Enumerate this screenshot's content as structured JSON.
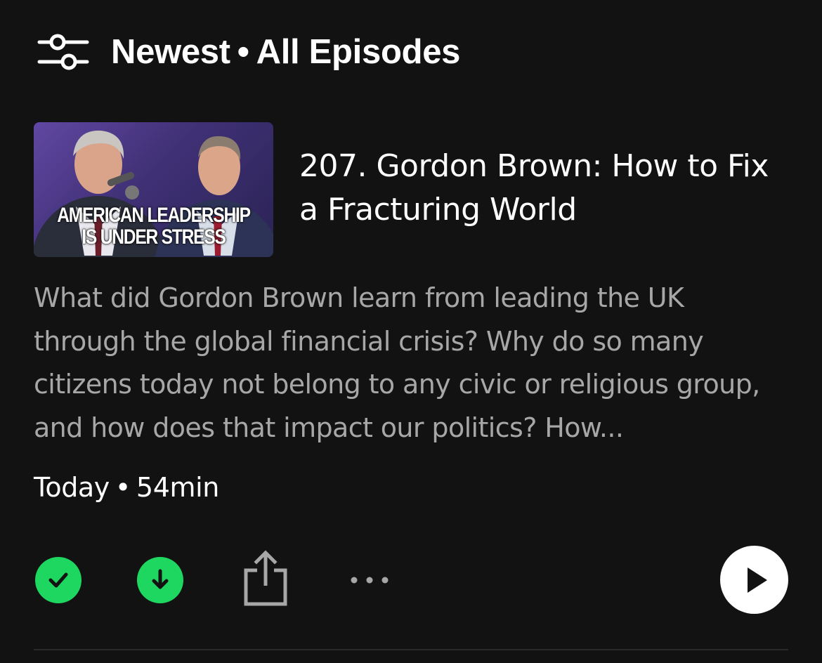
{
  "header": {
    "sort": "Newest",
    "separator": "•",
    "filter": "All Episodes"
  },
  "episode": {
    "thumbnail_caption_line1": "AMERICAN LEADERSHIP",
    "thumbnail_caption_line2": "IS UNDER STRESS",
    "title": "207. Gordon Brown: How to Fix a Fracturing World",
    "description": "What did Gordon Brown learn from leading the UK through the global financial crisis? Why do so many citizens today not belong to any civic or religious group, and how does that impact our politics? How...",
    "date": "Today",
    "separator": "•",
    "duration": "54min"
  },
  "actions": {
    "played_icon": "check-icon",
    "download_icon": "download-arrow-icon",
    "share_icon": "share-icon",
    "more_icon": "more-horizontal-icon",
    "play_icon": "play-icon"
  },
  "colors": {
    "background": "#121212",
    "accent_green": "#1ed760",
    "description_text": "#a7a7a7",
    "primary_text": "#ffffff"
  }
}
